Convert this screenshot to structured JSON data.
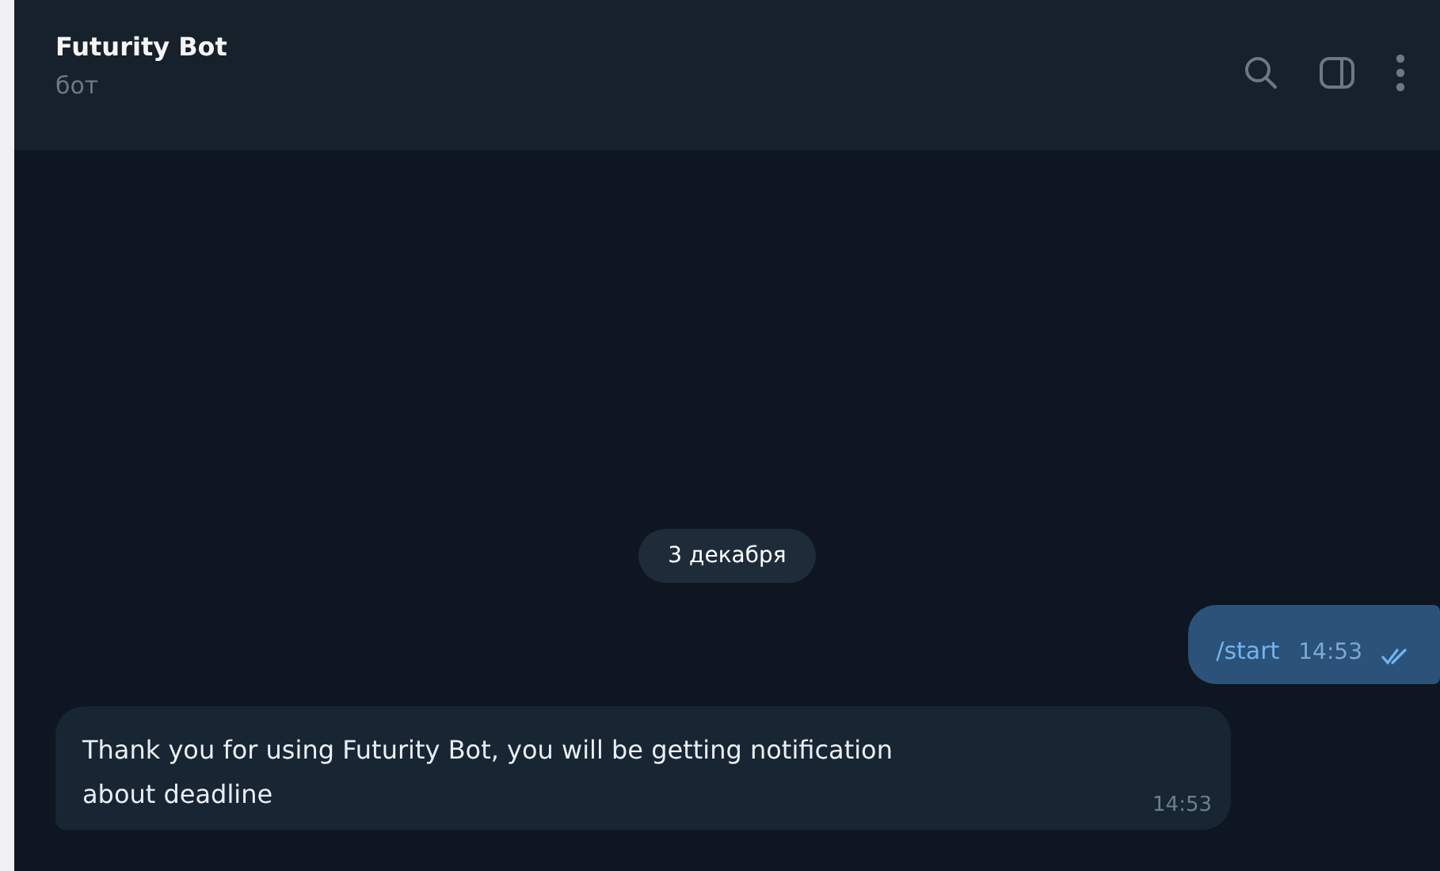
{
  "header": {
    "title": "Futurity Bot",
    "subtitle": "бот"
  },
  "date_badge": "3 декабря",
  "messages": [
    {
      "kind": "outgoing",
      "text": "/start",
      "time": "14:53",
      "read": true
    },
    {
      "kind": "incoming",
      "text": "Thank you for using Futurity Bot, you will be getting notification about deadline",
      "time": "14:53"
    }
  ]
}
